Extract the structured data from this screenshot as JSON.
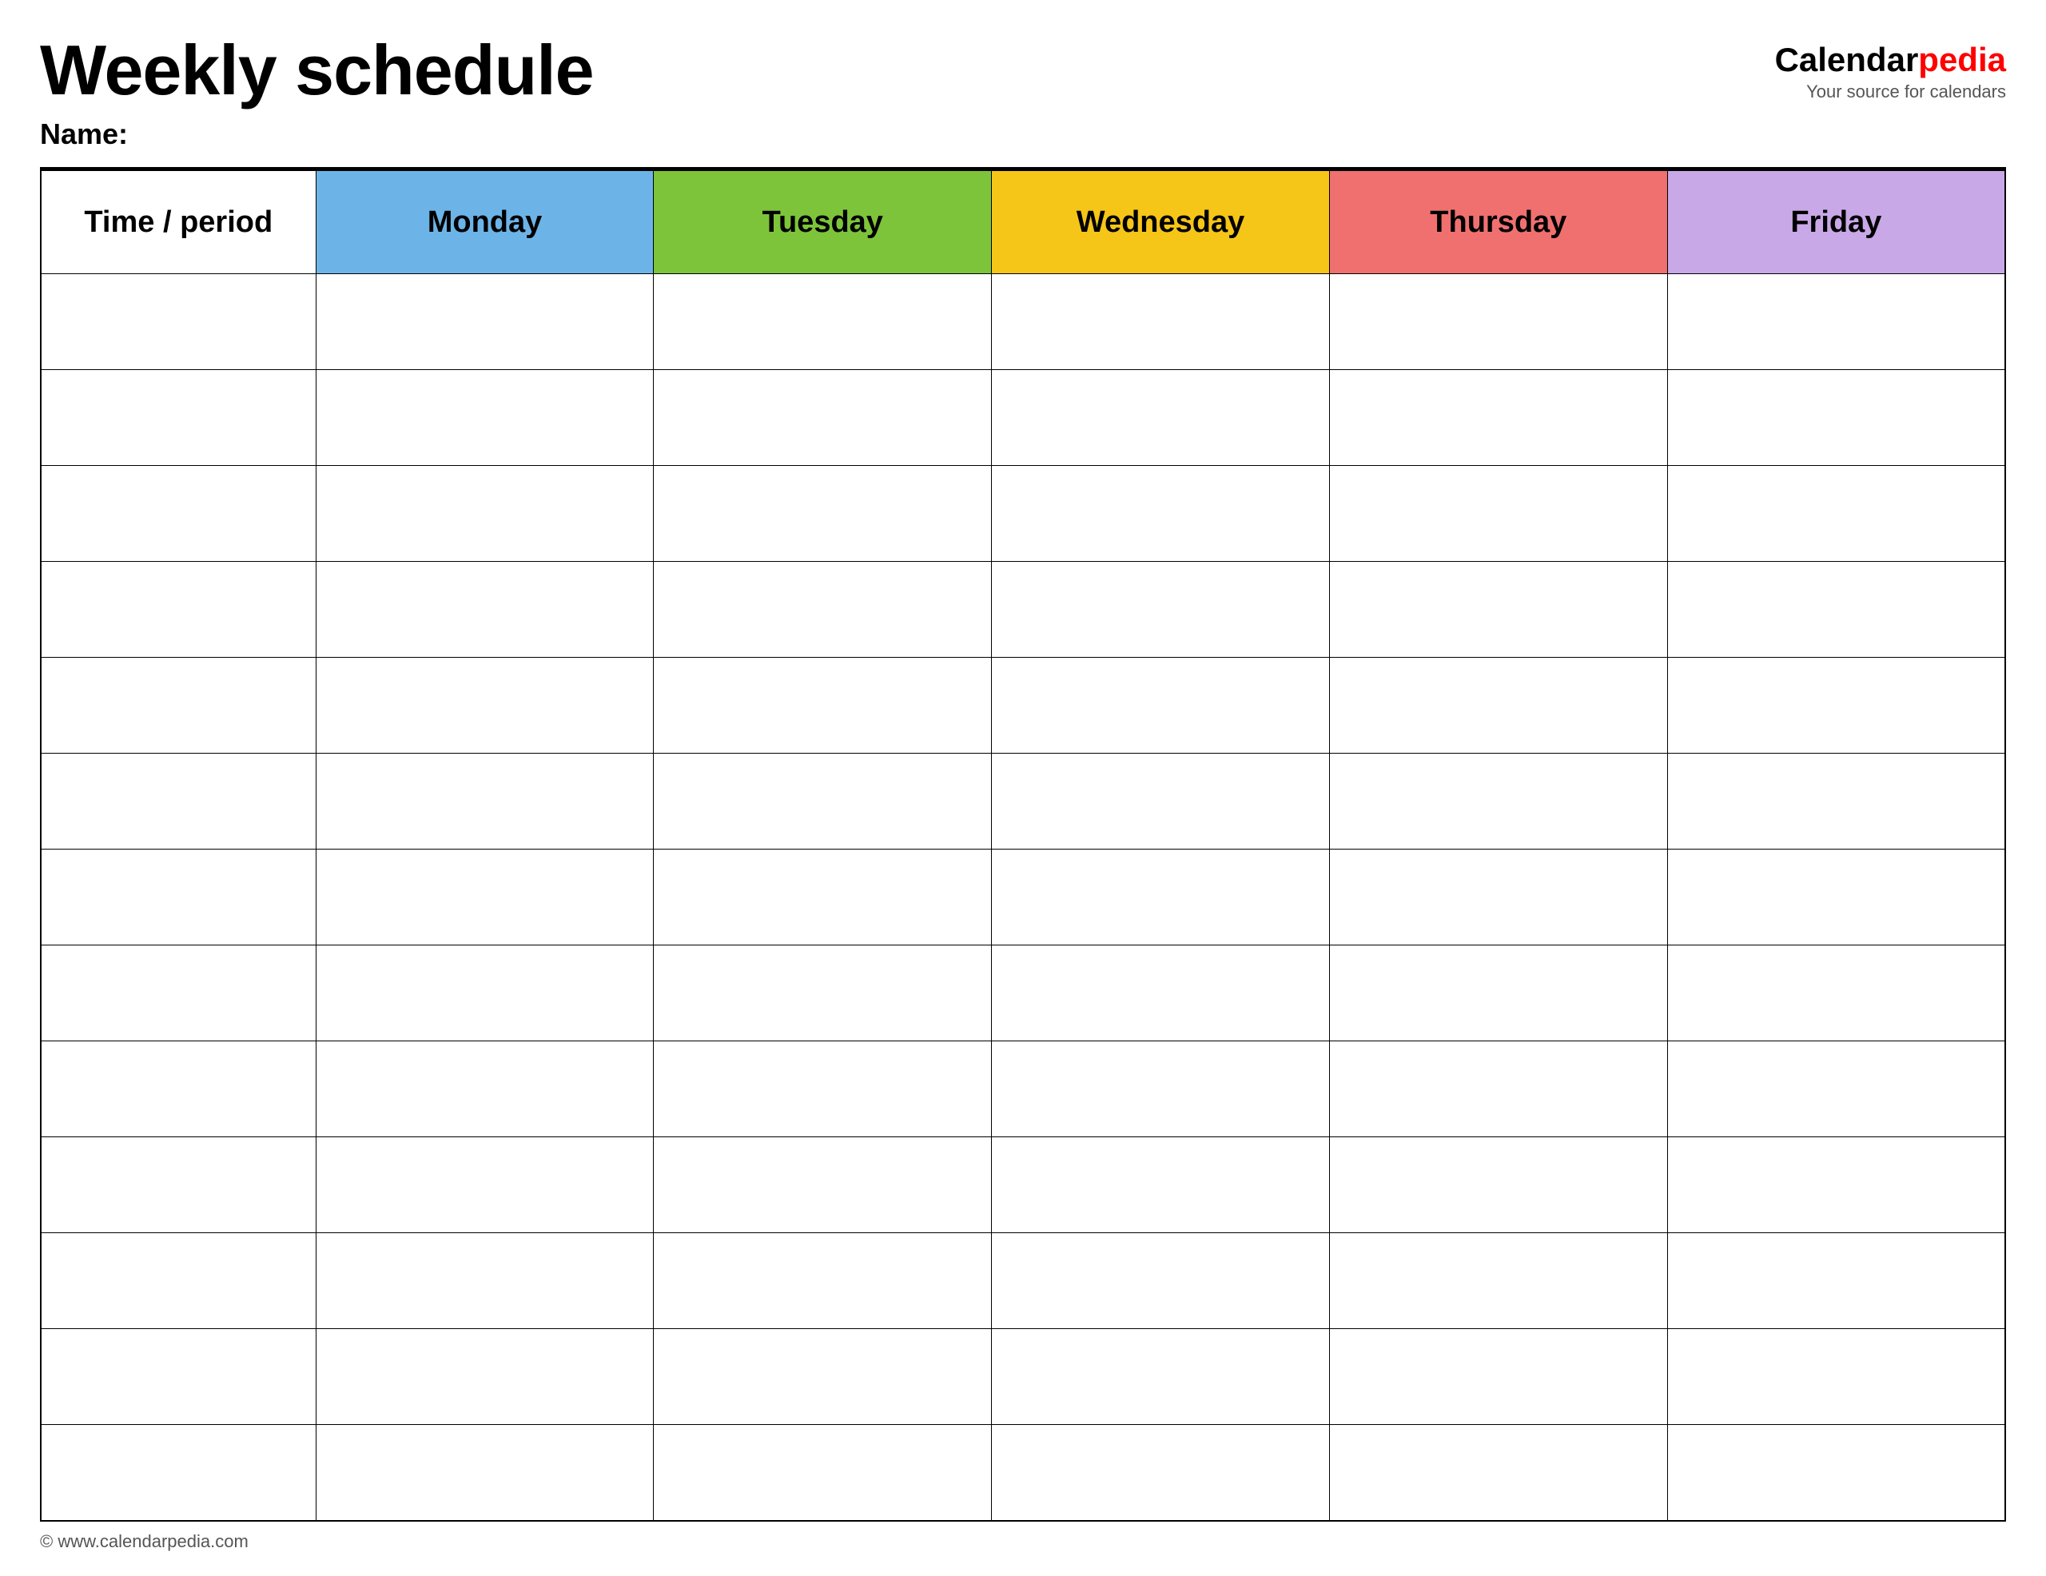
{
  "header": {
    "title": "Weekly schedule",
    "name_label": "Name:",
    "logo": {
      "calendar": "Calendar",
      "pedia": "pedia",
      "tagline": "Your source for calendars"
    }
  },
  "table": {
    "columns": [
      {
        "key": "time",
        "label": "Time / period",
        "color": "#ffffff",
        "class": "col-time"
      },
      {
        "key": "monday",
        "label": "Monday",
        "color": "#6cb4e8",
        "class": "col-monday"
      },
      {
        "key": "tuesday",
        "label": "Tuesday",
        "color": "#7dc43a",
        "class": "col-tuesday"
      },
      {
        "key": "wednesday",
        "label": "Wednesday",
        "color": "#f5c518",
        "class": "col-wednesday"
      },
      {
        "key": "thursday",
        "label": "Thursday",
        "color": "#f07070",
        "class": "col-thursday"
      },
      {
        "key": "friday",
        "label": "Friday",
        "color": "#c9a8e8",
        "class": "col-friday"
      }
    ],
    "row_count": 13
  },
  "footer": {
    "url": "© www.calendarpedia.com"
  }
}
